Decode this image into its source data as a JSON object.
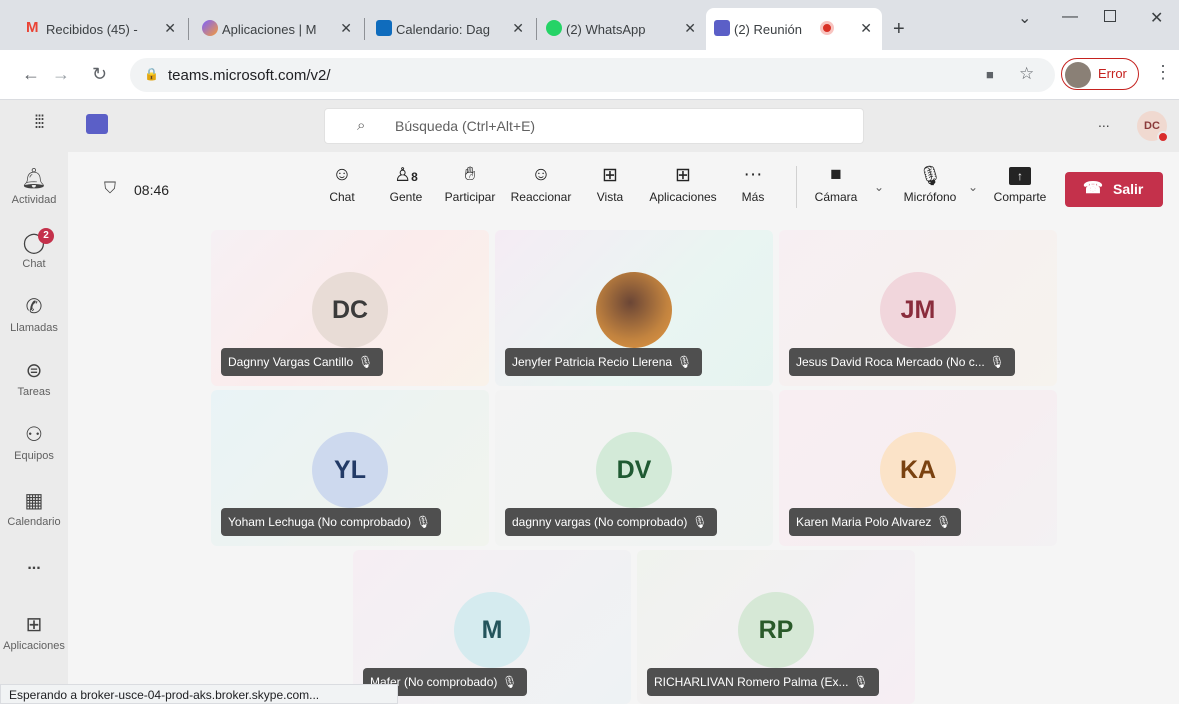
{
  "browser": {
    "tabs": [
      {
        "title": "Recibidos (45) -",
        "color": "#ea4335"
      },
      {
        "title": "Aplicaciones | M",
        "color": "#7b61ff"
      },
      {
        "title": "Calendario: Dag",
        "color": "#0f6cbd"
      },
      {
        "title": "(2) WhatsApp",
        "color": "#25d366"
      },
      {
        "title": "(2) Reunión",
        "color": "#5b5fc7"
      }
    ],
    "url": "teams.microsoft.com/v2/",
    "profile_label": "Error"
  },
  "teams": {
    "search_placeholder": "Búsqueda (Ctrl+Alt+E)",
    "user_initials": "DC",
    "more": "...",
    "rail": [
      {
        "label": "Actividad",
        "icon": "bell-icon",
        "glyph": "🔔"
      },
      {
        "label": "Chat",
        "icon": "chat-icon",
        "glyph": "💬",
        "badge": "2"
      },
      {
        "label": "Llamadas",
        "icon": "phone-icon",
        "glyph": "📞"
      },
      {
        "label": "Tareas",
        "icon": "tasks-icon",
        "glyph": "👜"
      },
      {
        "label": "Equipos",
        "icon": "teams-icon",
        "glyph": "👥"
      },
      {
        "label": "Calendario",
        "icon": "calendar-icon",
        "glyph": "📅"
      },
      {
        "label": "...",
        "icon": "more-icon",
        "glyph": ""
      },
      {
        "label": "Aplicaciones",
        "icon": "apps-icon",
        "glyph": "⊞"
      }
    ]
  },
  "meeting": {
    "timer": "08:46",
    "people_count": "8",
    "toolbar": {
      "chat": "Chat",
      "people": "Gente",
      "raise": "Participar",
      "react": "Reaccionar",
      "view": "Vista",
      "apps": "Aplicaciones",
      "more": "Más",
      "camera": "Cámara",
      "mic": "Micrófono",
      "share": "Comparte",
      "leave": "Salir"
    },
    "participants": [
      {
        "initials": "DC",
        "name": "Dagnny Vargas Cantillo",
        "color": "#e8dcd6"
      },
      {
        "initials": "",
        "name": "Jenyfer Patricia Recio Llerena",
        "color": "#b07a4a"
      },
      {
        "initials": "JM",
        "name": "Jesus David Roca Mercado (No c...",
        "color": "#f1d6dc"
      },
      {
        "initials": "YL",
        "name": "Yoham Lechuga (No comprobado)",
        "color": "#cdd9ee"
      },
      {
        "initials": "DV",
        "name": "dagnny vargas (No comprobado)",
        "color": "#d3ead8"
      },
      {
        "initials": "KA",
        "name": "Karen Maria Polo Alvarez",
        "color": "#fbe3c8"
      },
      {
        "initials": "M",
        "name": "Mafer (No comprobado)",
        "color": "#d5ebef"
      },
      {
        "initials": "RP",
        "name": "RICHARLIVAN Romero Palma (Ex...",
        "color": "#d6e8d6"
      }
    ]
  },
  "status_text": "Esperando a broker-usce-04-prod-aks.broker.skype.com..."
}
